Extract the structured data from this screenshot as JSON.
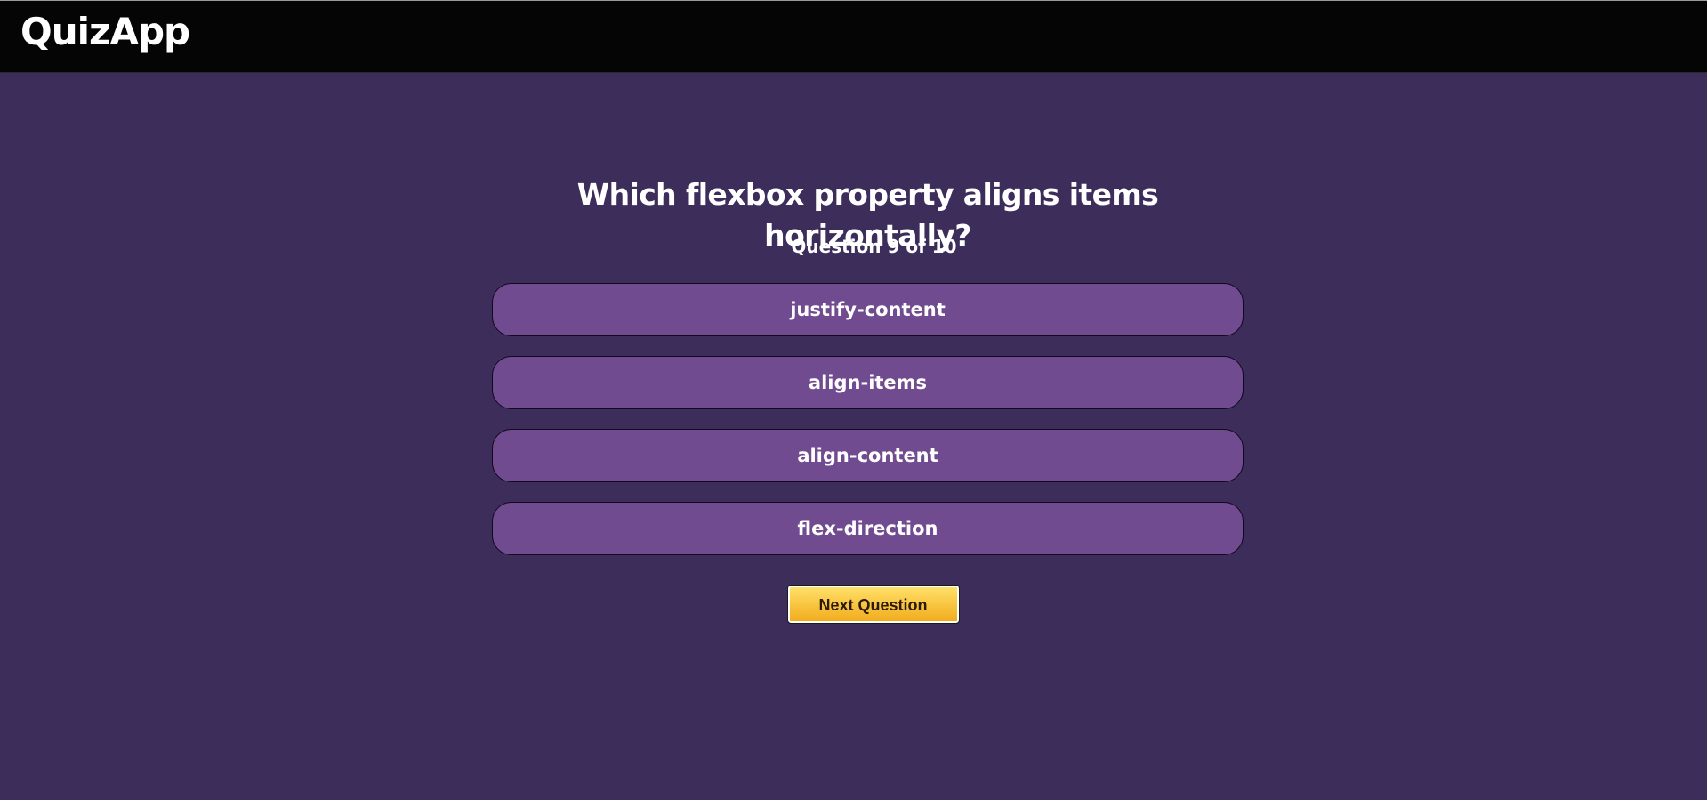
{
  "app": {
    "title": "QuizApp"
  },
  "quiz": {
    "question": "Which flexbox property aligns items horizontally?",
    "progress_text": "Question 9 of 10",
    "options": [
      "justify-content",
      "align-items",
      "align-content",
      "flex-direction"
    ],
    "next_label": "Next Question"
  },
  "colors": {
    "background": "#3c2d5a",
    "topbar": "#050505",
    "option_fill": "#704b8f",
    "next_button": "#ffc93c"
  }
}
